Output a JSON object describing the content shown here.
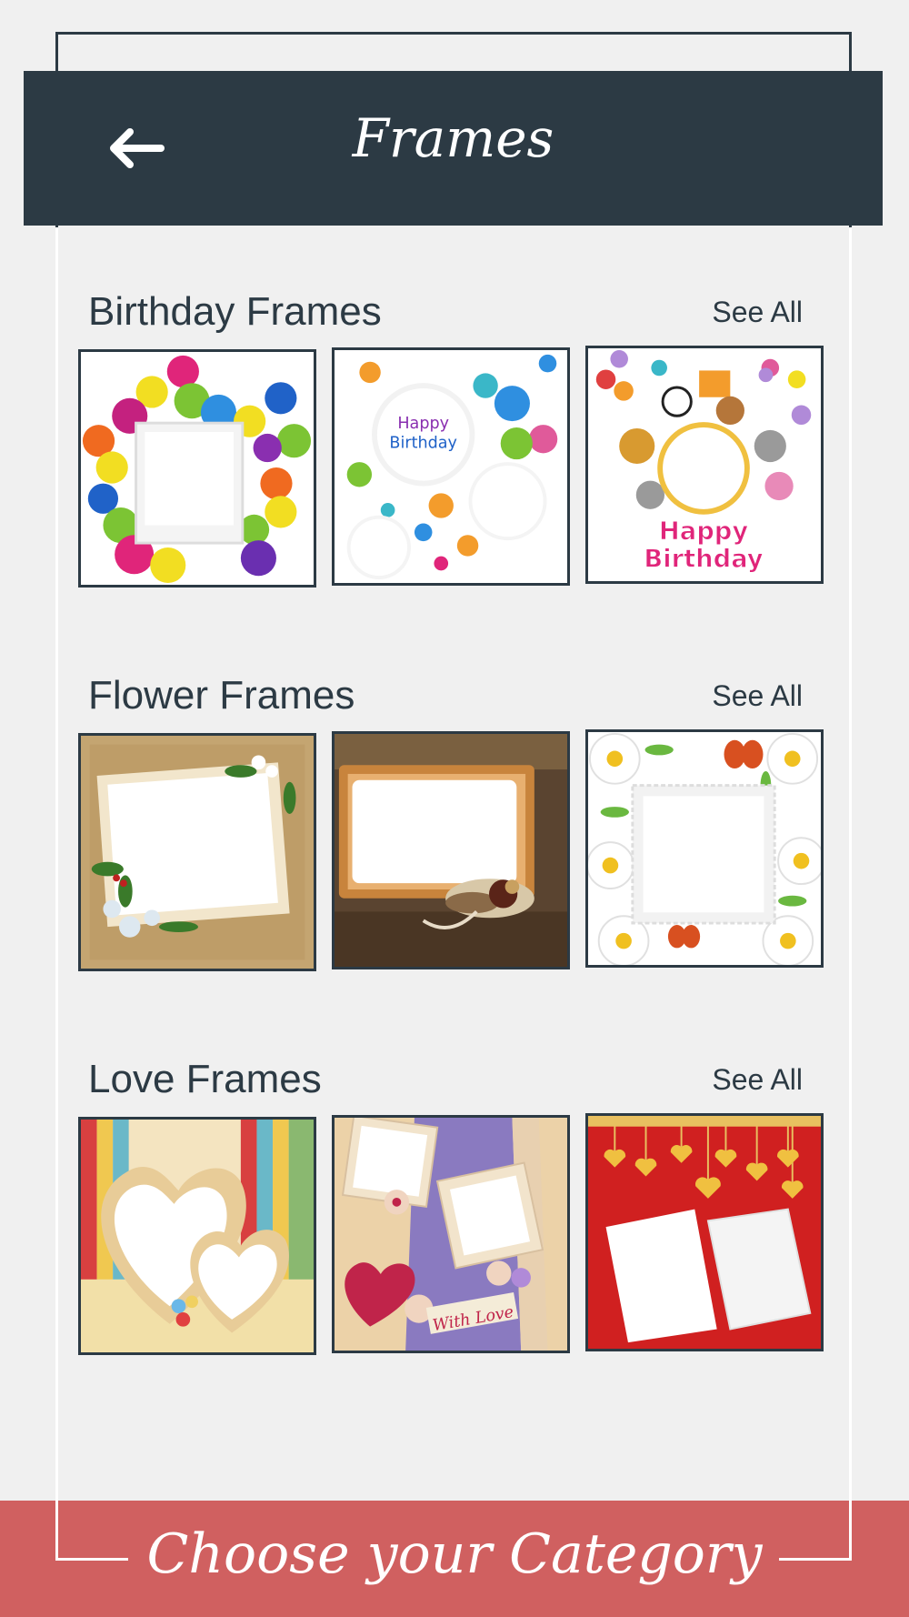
{
  "header": {
    "title": "Frames",
    "back_icon": "arrow-left-icon"
  },
  "sections": [
    {
      "title": "Birthday Frames",
      "see_all": "See All",
      "tiles": [
        {
          "name": "birthday-frame-balloons",
          "inner_text": ""
        },
        {
          "name": "birthday-frame-confetti",
          "inner_text": "Happy Birthday"
        },
        {
          "name": "birthday-frame-animals",
          "inner_text": "Happy Birthday"
        }
      ]
    },
    {
      "title": "Flower Frames",
      "see_all": "See All",
      "tiles": [
        {
          "name": "flower-frame-burlap"
        },
        {
          "name": "flower-frame-vintage"
        },
        {
          "name": "flower-frame-daisies"
        }
      ]
    },
    {
      "title": "Love Frames",
      "see_all": "See All",
      "tiles": [
        {
          "name": "love-frame-hearts"
        },
        {
          "name": "love-frame-scrapbook",
          "inner_text": "With Love"
        },
        {
          "name": "love-frame-red-hearts"
        }
      ]
    }
  ],
  "footer": {
    "label": "Choose your Category"
  },
  "colors": {
    "primary": "#2c3a44",
    "accent": "#d06060",
    "background": "#f0f0f0"
  }
}
